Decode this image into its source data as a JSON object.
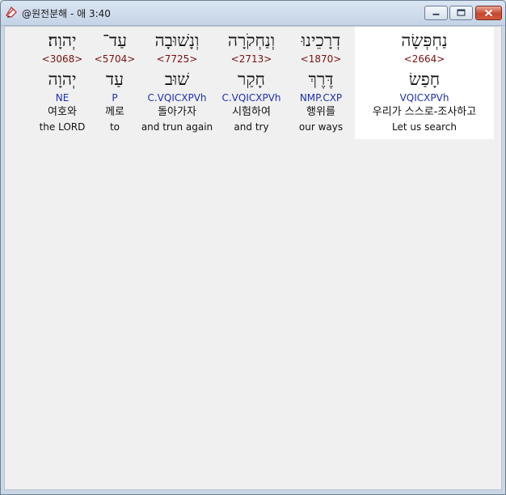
{
  "window": {
    "title": "@원전분해 - 애 3:40"
  },
  "words": [
    {
      "heb": "נַחְפְּשָׂה",
      "strong": "<2664>",
      "lemma": "חָפַשׂ",
      "morph": "VQICXPVh",
      "kor": "우리가 스스로-조사하고",
      "eng": "Let us search"
    },
    {
      "heb": "דְרָכֵינוּ",
      "strong": "<1870>",
      "lemma": "דֶּרֶךְ",
      "morph": "NMP.CXP",
      "kor": "행위를",
      "eng": "our ways"
    },
    {
      "heb": "וְנַחְקֹרָה",
      "strong": "<2713>",
      "lemma": "חָקַר",
      "morph": "C.VQICXPVh",
      "kor": "시험하여",
      "eng": "and try"
    },
    {
      "heb": "וְנָשׁוּבָה",
      "strong": "<7725>",
      "lemma": "שׁוּב",
      "morph": "C.VQICXPVh",
      "kor": "돌아가자",
      "eng": "and trun again"
    },
    {
      "heb": "עַד־",
      "strong": "<5704>",
      "lemma": "עַד",
      "morph": "P",
      "kor": "께로",
      "eng": "to"
    },
    {
      "heb": "יְהוָה׃",
      "strong": "<3068>",
      "lemma": "יְהוָה",
      "morph": "NE",
      "kor": "여호와",
      "eng": "the LORD"
    }
  ]
}
